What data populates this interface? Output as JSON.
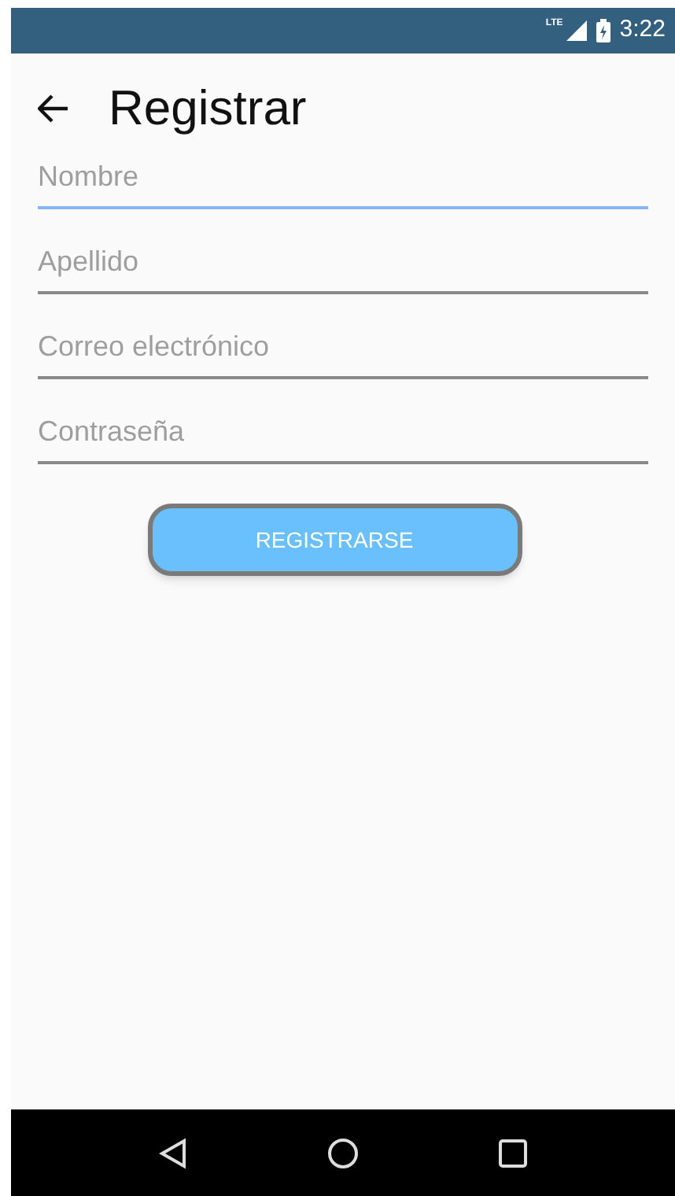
{
  "status_bar": {
    "network": "LTE",
    "time": "3:22"
  },
  "app_bar": {
    "title": "Registrar"
  },
  "fields": [
    {
      "placeholder": "Nombre",
      "focused": true
    },
    {
      "placeholder": "Apellido",
      "focused": false
    },
    {
      "placeholder": "Correo electrónico",
      "focused": false
    },
    {
      "placeholder": "Contraseña",
      "focused": false
    }
  ],
  "button": {
    "label": "REGISTRARSE"
  }
}
